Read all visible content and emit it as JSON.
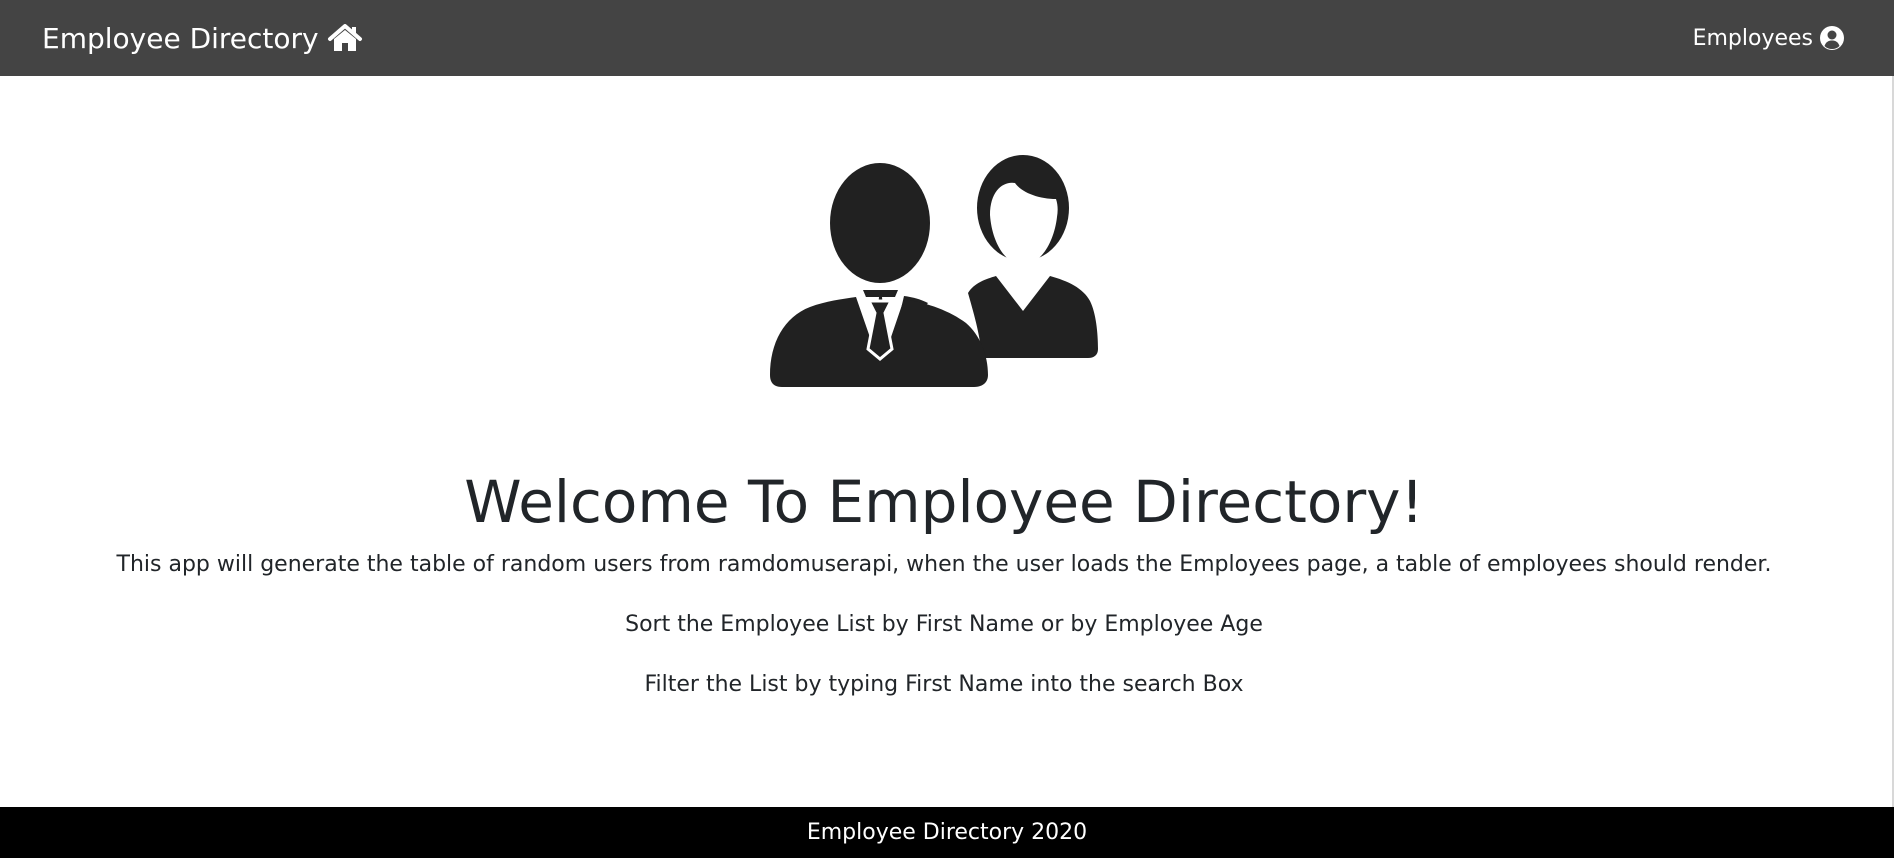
{
  "navbar": {
    "brand_label": "Employee Directory",
    "brand_icon": "home-icon",
    "employees_link": "Employees",
    "employees_icon": "user-circle-icon",
    "background": "#444444"
  },
  "hero": {
    "icon": "employees-icon",
    "title": "Welcome To Employee Directory!",
    "description": "This app will generate the table of random users from ramdomuserapi, when the user loads the Employees page, a table of employees should render.",
    "sort_hint": "Sort the Employee List by First Name or by Employee Age",
    "filter_hint": "Filter the List by typing First Name into the search Box"
  },
  "footer": {
    "text": "Employee Directory 2020",
    "background": "#000000"
  }
}
